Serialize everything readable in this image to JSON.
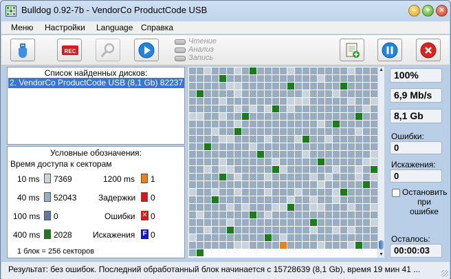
{
  "window": {
    "title": "Bulldog 0.92-7b - VendorCo ProductCode USB"
  },
  "menu": {
    "items": [
      "Меню",
      "Настройки",
      "Language",
      "Справка"
    ]
  },
  "toolbar": {
    "buttons": [
      {
        "name": "usb-button",
        "icon": "usb-icon"
      },
      {
        "name": "rec-button",
        "label": "REC"
      },
      {
        "name": "search-button",
        "icon": "magnifier-icon"
      },
      {
        "name": "play-button",
        "icon": "play-icon"
      },
      {
        "name": "log-button",
        "icon": "notebook-add-icon"
      },
      {
        "name": "pause-button",
        "icon": "pause-icon"
      },
      {
        "name": "stop-button",
        "icon": "stop-x-icon"
      }
    ],
    "modes": [
      "Чтение",
      "Анализ",
      "Запись"
    ]
  },
  "disks": {
    "title": "Список найденных дисков:",
    "items": [
      "2. VendorCo ProductCode USB  (8,1 Gb) 82237"
    ]
  },
  "legend": {
    "title": "Условные обозначения:",
    "subtitle": "Время доступа к секторам",
    "rows": [
      {
        "label": "10 ms",
        "count": "7369",
        "color": "#c9d3de"
      },
      {
        "label": "40 ms",
        "count": "52043",
        "color": "#99adc2"
      },
      {
        "label": "100 ms",
        "count": "0",
        "color": "#5d7b9d"
      },
      {
        "label": "400 ms",
        "count": "2028",
        "color": "#1a7d1a"
      }
    ],
    "right_rows": [
      {
        "label": "1200 ms",
        "count": "1",
        "color": "#ee7d1b"
      },
      {
        "label": "Задержки",
        "count": "0",
        "color": "#e01414"
      },
      {
        "label": "Ошибки",
        "count": "0",
        "color": "#e01414",
        "glyph": "✕"
      },
      {
        "label": "Искажения",
        "count": "0",
        "color": "#1414d4",
        "glyph": "F"
      }
    ],
    "footer": "1 блок = 256 секторов"
  },
  "stats": {
    "progress": "100%",
    "speed": "6,9 Mb/s",
    "size": "8,1 Gb",
    "errors_label": "Ошибки:",
    "errors_value": "0",
    "distortions_label": "Искажения:",
    "distortions_value": "0",
    "stop_on_error": "Остановить при ошибке",
    "remaining_label": "Осталось:",
    "remaining_value": "00:00:03"
  },
  "status": {
    "text": "Результат: без ошибок. Последний обработанный блок начинается с 15728639 (8,1 Gb), время 19 мин 41 ..."
  },
  "colors": {
    "light": "#c9d3de",
    "medium": "#99adc2",
    "green": "#1a7d1a",
    "orange": "#ee7d1b"
  }
}
